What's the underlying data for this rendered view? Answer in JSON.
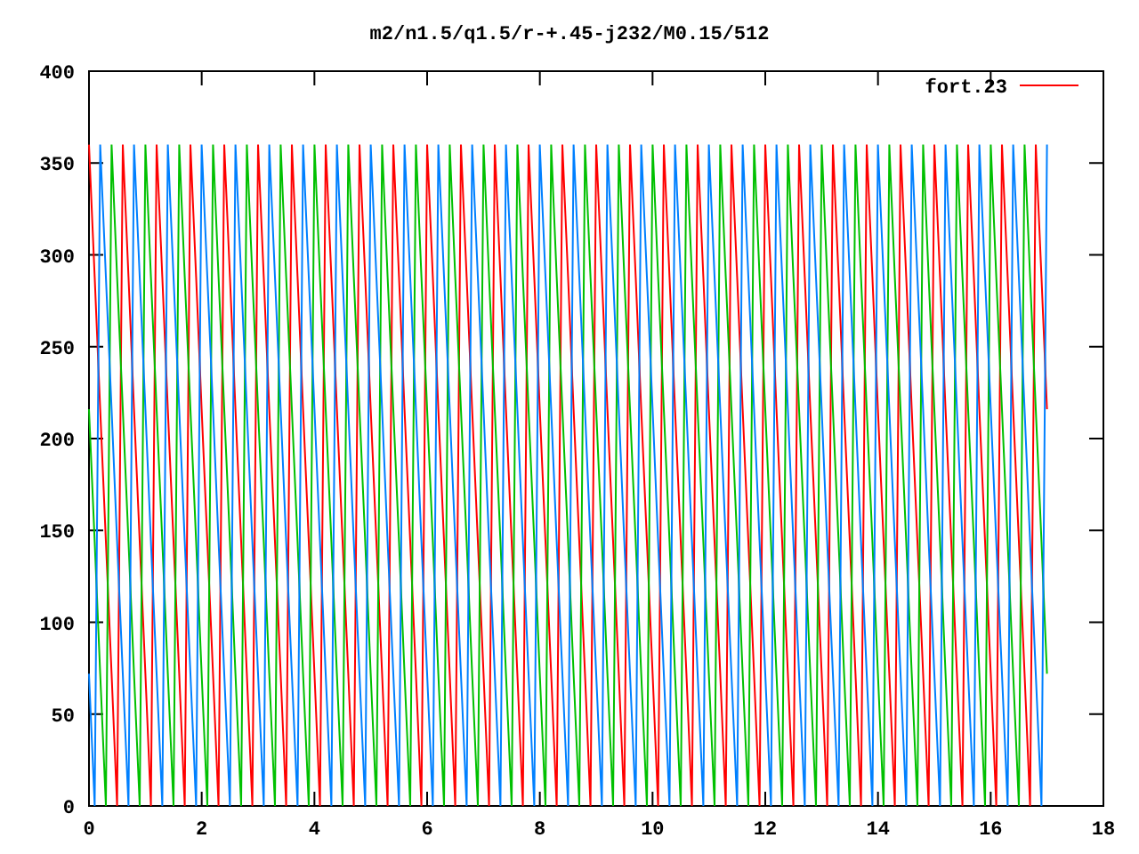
{
  "plot": {
    "chart_data": {
      "type": "line",
      "title": "m2/n1.5/q1.5/r-+.45-j232/M0.15/512",
      "xlim": [
        0,
        18
      ],
      "ylim": [
        0,
        400
      ],
      "xticks": [
        0,
        2,
        4,
        6,
        8,
        10,
        12,
        14,
        16,
        18
      ],
      "yticks": [
        0,
        50,
        100,
        150,
        200,
        250,
        300,
        350,
        400
      ],
      "x": [
        0,
        0.1,
        0.2,
        0.3,
        0.4,
        0.5,
        0.6,
        0.7,
        0.8,
        0.9,
        1,
        1.1,
        1.2,
        1.3,
        1.4,
        1.5,
        1.6,
        1.7,
        1.8,
        1.9,
        2,
        2.1,
        2.2,
        2.3,
        2.4,
        2.5,
        2.6,
        2.7,
        2.8,
        2.9,
        3,
        3.1,
        3.2,
        3.3,
        3.4,
        3.5,
        3.6,
        3.7,
        3.8,
        3.9,
        4,
        4.1,
        4.2,
        4.3,
        4.4,
        4.5,
        4.6,
        4.7,
        4.8,
        4.9,
        5,
        5.1,
        5.2,
        5.3,
        5.4,
        5.5,
        5.6,
        5.7,
        5.8,
        5.9,
        6,
        6.1,
        6.2,
        6.3,
        6.4,
        6.5,
        6.6,
        6.7,
        6.8,
        6.9,
        7,
        7.1,
        7.2,
        7.3,
        7.4,
        7.5,
        7.6,
        7.7,
        7.8,
        7.9,
        8,
        8.1,
        8.2,
        8.3,
        8.4,
        8.5,
        8.6,
        8.7,
        8.8,
        8.9,
        9,
        9.1,
        9.2,
        9.3,
        9.4,
        9.5,
        9.6,
        9.7,
        9.8,
        9.9,
        10,
        10.1,
        10.2,
        10.3,
        10.4,
        10.5,
        10.6,
        10.7,
        10.8,
        10.9,
        11,
        11.1,
        11.2,
        11.3,
        11.4,
        11.5,
        11.6,
        11.7,
        11.8,
        11.9,
        12,
        12.1,
        12.2,
        12.3,
        12.4,
        12.5,
        12.6,
        12.7,
        12.8,
        12.9,
        13,
        13.1,
        13.2,
        13.3,
        13.4,
        13.5,
        13.6,
        13.7,
        13.8,
        13.9,
        14,
        14.1,
        14.2,
        14.3,
        14.4,
        14.5,
        14.6,
        14.7,
        14.8,
        14.9,
        15,
        15.1,
        15.2,
        15.3,
        15.4,
        15.5,
        15.6,
        15.7,
        15.8,
        15.9,
        16,
        16.1,
        16.2,
        16.3,
        16.4,
        16.5,
        16.6,
        16.7,
        16.8,
        16.9,
        17
      ],
      "series": [
        {
          "name": "fort.23",
          "color": "#ff0000",
          "values": [
            360,
            288,
            216,
            144,
            72,
            0,
            360,
            288,
            216,
            144,
            72,
            0,
            360,
            288,
            216,
            144,
            72,
            0,
            360,
            288,
            216,
            144,
            72,
            0,
            360,
            288,
            216,
            144,
            72,
            0,
            360,
            288,
            216,
            144,
            72,
            0,
            360,
            288,
            216,
            144,
            72,
            0,
            360,
            288,
            216,
            144,
            72,
            0,
            360,
            288,
            216,
            144,
            72,
            0,
            360,
            288,
            216,
            144,
            72,
            0,
            360,
            288,
            216,
            144,
            72,
            0,
            360,
            288,
            216,
            144,
            72,
            0,
            360,
            288,
            216,
            144,
            72,
            0,
            360,
            288,
            216,
            144,
            72,
            0,
            360,
            288,
            216,
            144,
            72,
            0,
            360,
            288,
            216,
            144,
            72,
            0,
            360,
            288,
            216,
            144,
            72,
            0,
            360,
            288,
            216,
            144,
            72,
            0,
            360,
            288,
            216,
            144,
            72,
            0,
            360,
            288,
            216,
            144,
            72,
            0,
            360,
            288,
            216,
            144,
            72,
            0,
            360,
            288,
            216,
            144,
            72,
            0,
            360,
            288,
            216,
            144,
            72,
            0,
            360,
            288,
            216,
            144,
            72,
            0,
            360,
            288,
            216,
            144,
            72,
            0,
            360,
            288,
            216,
            144,
            72,
            0,
            360,
            288,
            216,
            144,
            72,
            0,
            360,
            288,
            216,
            144,
            72,
            0,
            360,
            288,
            216
          ]
        },
        {
          "color": "#00c000",
          "values": [
            216,
            144,
            72,
            0,
            360,
            288,
            216,
            144,
            72,
            0,
            360,
            288,
            216,
            144,
            72,
            0,
            360,
            288,
            216,
            144,
            72,
            0,
            360,
            288,
            216,
            144,
            72,
            0,
            360,
            288,
            216,
            144,
            72,
            0,
            360,
            288,
            216,
            144,
            72,
            0,
            360,
            288,
            216,
            144,
            72,
            0,
            360,
            288,
            216,
            144,
            72,
            0,
            360,
            288,
            216,
            144,
            72,
            0,
            360,
            288,
            216,
            144,
            72,
            0,
            360,
            288,
            216,
            144,
            72,
            0,
            360,
            288,
            216,
            144,
            72,
            0,
            360,
            288,
            216,
            144,
            72,
            0,
            360,
            288,
            216,
            144,
            72,
            0,
            360,
            288,
            216,
            144,
            72,
            0,
            360,
            288,
            216,
            144,
            72,
            0,
            360,
            288,
            216,
            144,
            72,
            0,
            360,
            288,
            216,
            144,
            72,
            0,
            360,
            288,
            216,
            144,
            72,
            0,
            360,
            288,
            216,
            144,
            72,
            0,
            360,
            288,
            216,
            144,
            72,
            0,
            360,
            288,
            216,
            144,
            72,
            0,
            360,
            288,
            216,
            144,
            72,
            0,
            360,
            288,
            216,
            144,
            72,
            0,
            360,
            288,
            216,
            144,
            72,
            0,
            360,
            288,
            216,
            144,
            72,
            0,
            360,
            288,
            216,
            144,
            72,
            0,
            360,
            288,
            216,
            144,
            72
          ]
        },
        {
          "color": "#0080ff",
          "values": [
            72,
            0,
            360,
            288,
            216,
            144,
            72,
            0,
            360,
            288,
            216,
            144,
            72,
            0,
            360,
            288,
            216,
            144,
            72,
            0,
            360,
            288,
            216,
            144,
            72,
            0,
            360,
            288,
            216,
            144,
            72,
            0,
            360,
            288,
            216,
            144,
            72,
            0,
            360,
            288,
            216,
            144,
            72,
            0,
            360,
            288,
            216,
            144,
            72,
            0,
            360,
            288,
            216,
            144,
            72,
            0,
            360,
            288,
            216,
            144,
            72,
            0,
            360,
            288,
            216,
            144,
            72,
            0,
            360,
            288,
            216,
            144,
            72,
            0,
            360,
            288,
            216,
            144,
            72,
            0,
            360,
            288,
            216,
            144,
            72,
            0,
            360,
            288,
            216,
            144,
            72,
            0,
            360,
            288,
            216,
            144,
            72,
            0,
            360,
            288,
            216,
            144,
            72,
            0,
            360,
            288,
            216,
            144,
            72,
            0,
            360,
            288,
            216,
            144,
            72,
            0,
            360,
            288,
            216,
            144,
            72,
            0,
            360,
            288,
            216,
            144,
            72,
            0,
            360,
            288,
            216,
            144,
            72,
            0,
            360,
            288,
            216,
            144,
            72,
            0,
            360,
            288,
            216,
            144,
            72,
            0,
            360,
            288,
            216,
            144,
            72,
            0,
            360,
            288,
            216,
            144,
            72,
            0,
            360,
            288,
            216,
            144,
            72,
            0,
            360,
            288,
            216,
            144,
            72,
            0,
            360
          ]
        }
      ]
    }
  }
}
